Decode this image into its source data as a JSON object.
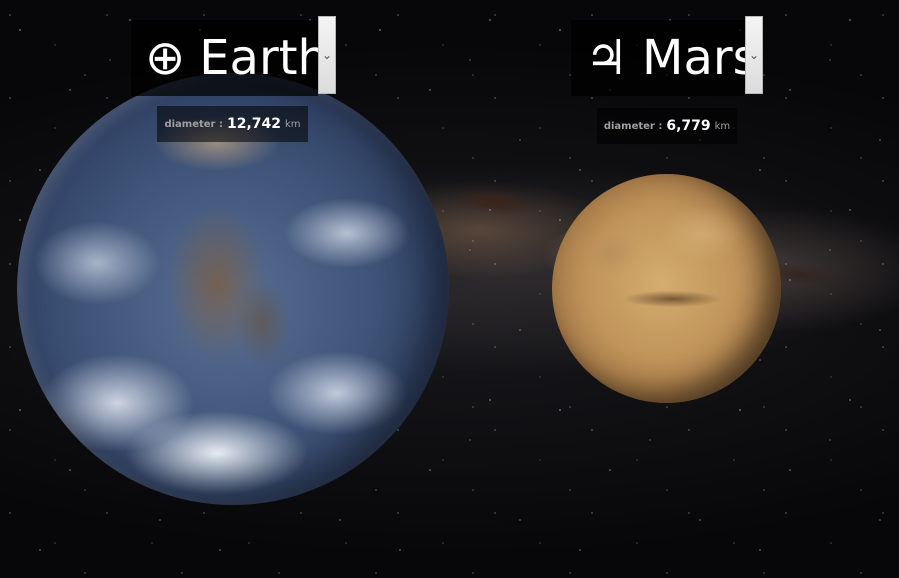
{
  "planets": [
    {
      "symbol": "⊕",
      "name": "Earth",
      "diameter_label": "diameter :",
      "diameter_value": "12,742",
      "diameter_unit": "km",
      "color": "#3f5478"
    },
    {
      "symbol": "♃",
      "name": "Mars",
      "diameter_label": "diameter :",
      "diameter_value": "6,779",
      "diameter_unit": "km",
      "color": "#c0935a"
    }
  ],
  "dropdown_icon": "chevron-down-icon",
  "dropdown_glyph": "⌄"
}
